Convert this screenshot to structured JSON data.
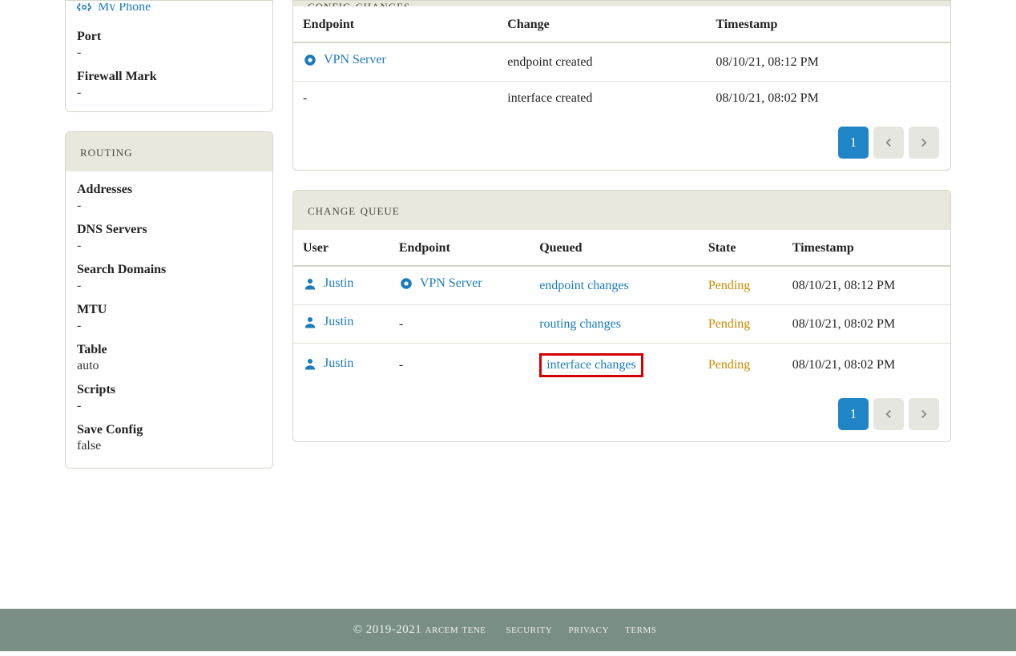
{
  "sidebar": {
    "top_device_link": "My Phone",
    "port": {
      "label": "Port",
      "value": "-"
    },
    "firewall": {
      "label": "Firewall Mark",
      "value": "-"
    },
    "routing_header": "routing",
    "addresses": {
      "label": "Addresses",
      "value": "-"
    },
    "dns": {
      "label": "DNS Servers",
      "value": "-"
    },
    "search_domains": {
      "label": "Search Domains",
      "value": "-"
    },
    "mtu": {
      "label": "MTU",
      "value": "-"
    },
    "table": {
      "label": "Table",
      "value": "auto"
    },
    "scripts": {
      "label": "Scripts",
      "value": "-"
    },
    "save_config": {
      "label": "Save Config",
      "value": "false"
    }
  },
  "config_changes": {
    "header": "config changes",
    "columns": [
      "Endpoint",
      "Change",
      "Timestamp"
    ],
    "rows": [
      {
        "endpoint": "VPN Server",
        "has_endpoint": true,
        "change": "endpoint created",
        "timestamp": "08/10/21, 08:12 PM"
      },
      {
        "endpoint": "-",
        "has_endpoint": false,
        "change": "interface created",
        "timestamp": "08/10/21, 08:02 PM"
      }
    ],
    "page": "1"
  },
  "change_queue": {
    "header": "change queue",
    "columns": [
      "User",
      "Endpoint",
      "Queued",
      "State",
      "Timestamp"
    ],
    "rows": [
      {
        "user": "Justin",
        "endpoint": "VPN Server",
        "has_endpoint": true,
        "queued": "endpoint changes",
        "state": "Pending",
        "timestamp": "08/10/21, 08:12 PM",
        "highlight": false
      },
      {
        "user": "Justin",
        "endpoint": "-",
        "has_endpoint": false,
        "queued": "routing changes",
        "state": "Pending",
        "timestamp": "08/10/21, 08:02 PM",
        "highlight": false
      },
      {
        "user": "Justin",
        "endpoint": "-",
        "has_endpoint": false,
        "queued": "interface changes",
        "state": "Pending",
        "timestamp": "08/10/21, 08:02 PM",
        "highlight": true
      }
    ],
    "page": "1"
  },
  "footer": {
    "copyright": "© 2019-2021 arcem tene",
    "links": [
      "security",
      "privacy",
      "terms"
    ]
  }
}
